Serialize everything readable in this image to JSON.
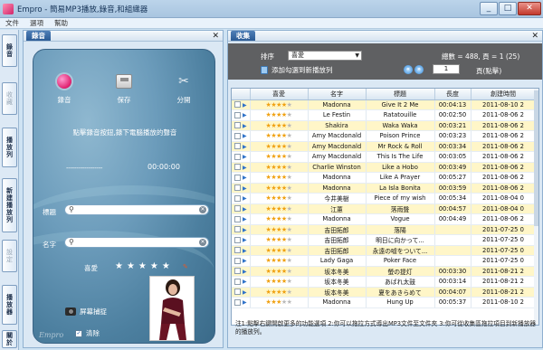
{
  "window": {
    "title": "Empro - 簡易MP3播放,錄音,和組織器",
    "buttons": [
      "_",
      "□",
      "✕"
    ]
  },
  "menu": [
    "文件",
    "選項",
    "幫助"
  ],
  "side_tabs": [
    "錄音",
    "收藏",
    "播放列",
    "新建播放列",
    "設定",
    "播放器",
    "關於"
  ],
  "recorder_panel": {
    "tab_title": "錄音",
    "close": "✕",
    "buttons": {
      "record": "錄音",
      "save": "保存",
      "split": "分開"
    },
    "hint": "點擊錄音按鈕,錄下電腦播放的聲音",
    "dashes": "------------------",
    "timer": "00:00:00",
    "title_label": "標題",
    "title_value": "",
    "name_label": "名字",
    "name_value": "",
    "rating_label": "喜愛",
    "rating_stars": "★★★★★",
    "rating_clear": "✎",
    "screenshot_label": "屏幕捕捉",
    "clear_label": "清除",
    "clear_checked": "✓",
    "logo": "Empro"
  },
  "favorites_panel": {
    "tab_title": "收集",
    "close": "✕",
    "sort_label": "排序",
    "sort_value": "喜愛",
    "total": "總數 = 488, 頁 = 1 (25)",
    "add_label": "添加勾選到新播放列",
    "page_value": "1",
    "page_label": "頁(點擊)",
    "nav_prev": "«",
    "nav_next": "»",
    "columns": [
      "",
      "喜愛",
      "名字",
      "標題",
      "長度",
      "創建時間"
    ],
    "rows": [
      {
        "rating": 4,
        "name": "Madonna",
        "title": "Give It 2 Me",
        "length": "00:04:13",
        "created": "2011-08-10 2"
      },
      {
        "rating": 4,
        "name": "Le Festin",
        "title": "Ratatouille",
        "length": "00:02:50",
        "created": "2011-08-06 2"
      },
      {
        "rating": 4,
        "name": "Shakira",
        "title": "Waka Waka",
        "length": "00:03:21",
        "created": "2011-08-06 2"
      },
      {
        "rating": 4,
        "name": "Amy Macdonald",
        "title": "Poison Prince",
        "length": "00:03:23",
        "created": "2011-08-06 2"
      },
      {
        "rating": 4,
        "name": "Amy Macdonald",
        "title": "Mr Rock & Roll",
        "length": "00:03:34",
        "created": "2011-08-06 2"
      },
      {
        "rating": 4,
        "name": "Amy Macdonald",
        "title": "This Is The Life",
        "length": "00:03:05",
        "created": "2011-08-06 2"
      },
      {
        "rating": 4,
        "name": "Charlie Winston",
        "title": "Like a Hobo",
        "length": "00:03:49",
        "created": "2011-08-06 2"
      },
      {
        "rating": 4,
        "name": "Madonna",
        "title": "Like A Prayer",
        "length": "00:05:27",
        "created": "2011-08-06 2"
      },
      {
        "rating": 4,
        "name": "Madonna",
        "title": "La Isla Bonita",
        "length": "00:03:59",
        "created": "2011-08-06 2"
      },
      {
        "rating": 4,
        "name": "今井美樹",
        "title": "Piece of my wish",
        "length": "00:05:34",
        "created": "2011-08-04 0"
      },
      {
        "rating": 4,
        "name": "江蕙",
        "title": "落雨聲",
        "length": "00:04:57",
        "created": "2011-08-04 0"
      },
      {
        "rating": 4,
        "name": "Madonna",
        "title": "Vogue",
        "length": "00:04:49",
        "created": "2011-08-06 2"
      },
      {
        "rating": 4,
        "name": "吉田拓郎",
        "title": "落陽",
        "length": "",
        "created": "2011-07-25 0"
      },
      {
        "rating": 4,
        "name": "吉田拓郎",
        "title": "明日に向かって...",
        "length": "",
        "created": "2011-07-25 0"
      },
      {
        "rating": 4,
        "name": "吉田拓郎",
        "title": "永遠の嘘をついて...",
        "length": "",
        "created": "2011-07-25 0"
      },
      {
        "rating": 4,
        "name": "Lady Gaga",
        "title": "Poker Face",
        "length": "",
        "created": "2011-07-25 0"
      },
      {
        "rating": 4,
        "name": "坂本冬美",
        "title": "螢の提灯",
        "length": "00:03:30",
        "created": "2011-08-21 2"
      },
      {
        "rating": 4,
        "name": "坂本冬美",
        "title": "あばれ太鼓",
        "length": "00:03:14",
        "created": "2011-08-21 2"
      },
      {
        "rating": 4,
        "name": "坂本冬美",
        "title": "夏をあきらめて",
        "length": "00:04:07",
        "created": "2011-08-21 2"
      },
      {
        "rating": 3,
        "name": "Madonna",
        "title": "Hung Up",
        "length": "00:05:37",
        "created": "2011-08-10 2"
      }
    ],
    "footnote": "注1:點擊右鍵開啟更多的功能選項 2:你可以拖拉方式導出MP3文件至文件夾 3:你可從收集區拖拉項目到新播放器的播放列。"
  },
  "colors": {
    "accent": "#2a5a94",
    "row_alt": "#fff6c8",
    "toolbar": "#5f6062",
    "recorder_bg": "#6c9cbb"
  },
  "icons": [
    "record-icon",
    "save-icon",
    "scissors-icon",
    "search-icon",
    "clear-icon",
    "star-icon",
    "camera-icon",
    "trash-icon",
    "play-icon"
  ]
}
